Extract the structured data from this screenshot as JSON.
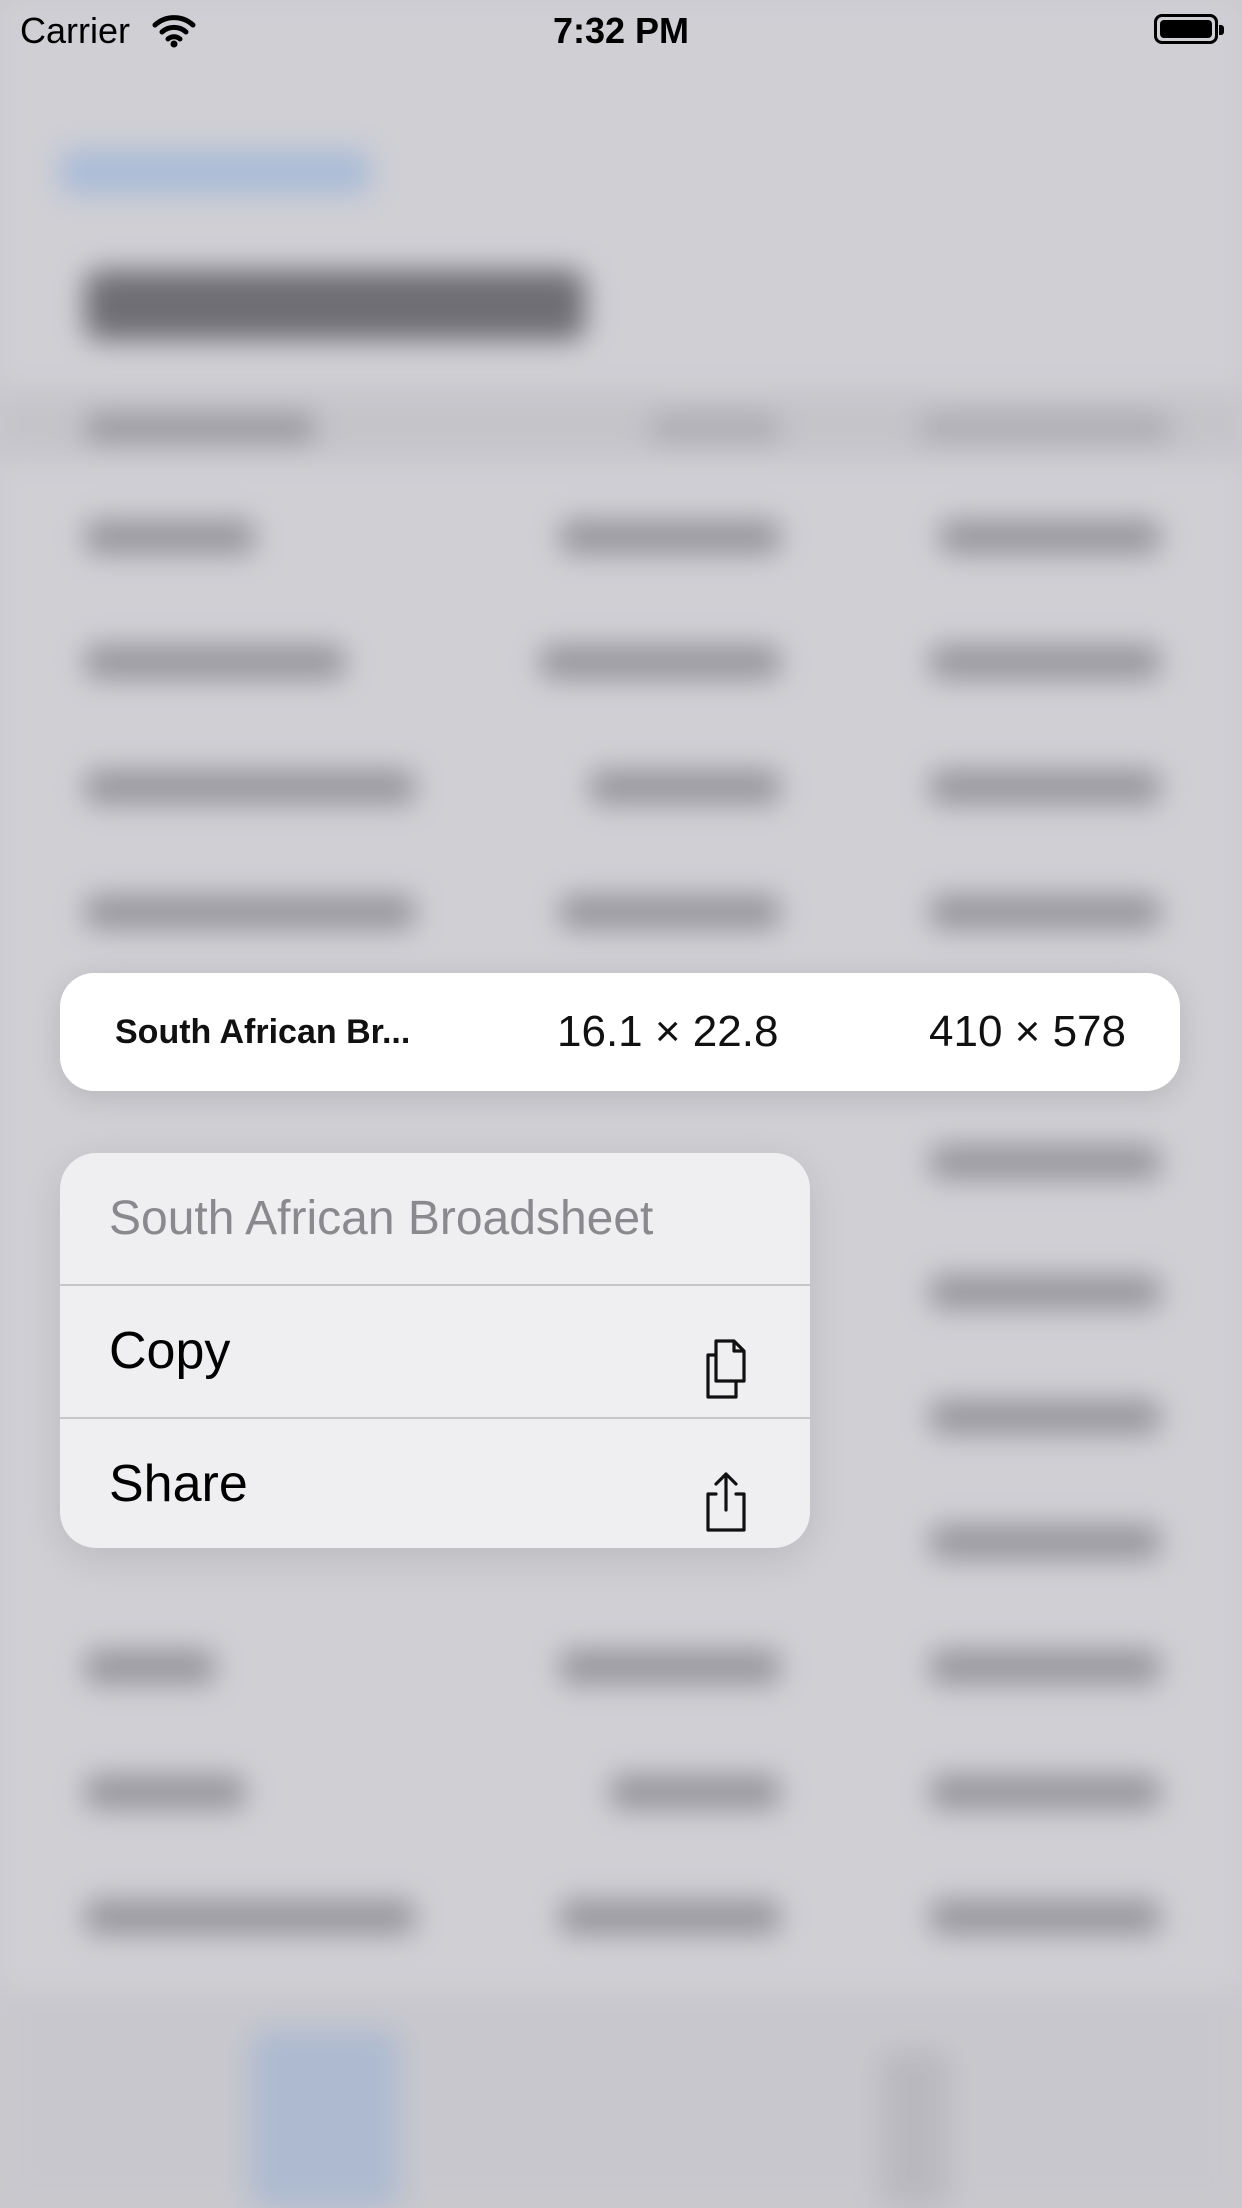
{
  "status_bar": {
    "carrier": "Carrier",
    "time": "7:32 PM"
  },
  "preview_row": {
    "name": "South African Br...",
    "size_in": "16.1 × 22.8",
    "size_mm": "410 × 578"
  },
  "context_menu": {
    "title": "South African Broadsheet",
    "items": [
      {
        "label": "Copy",
        "icon": "copy-icon"
      },
      {
        "label": "Share",
        "icon": "share-icon"
      }
    ]
  },
  "colors": {
    "menu_background": "#efeff1",
    "menu_header_text": "#8a8a8e",
    "backdrop": "#c9c9ce"
  }
}
